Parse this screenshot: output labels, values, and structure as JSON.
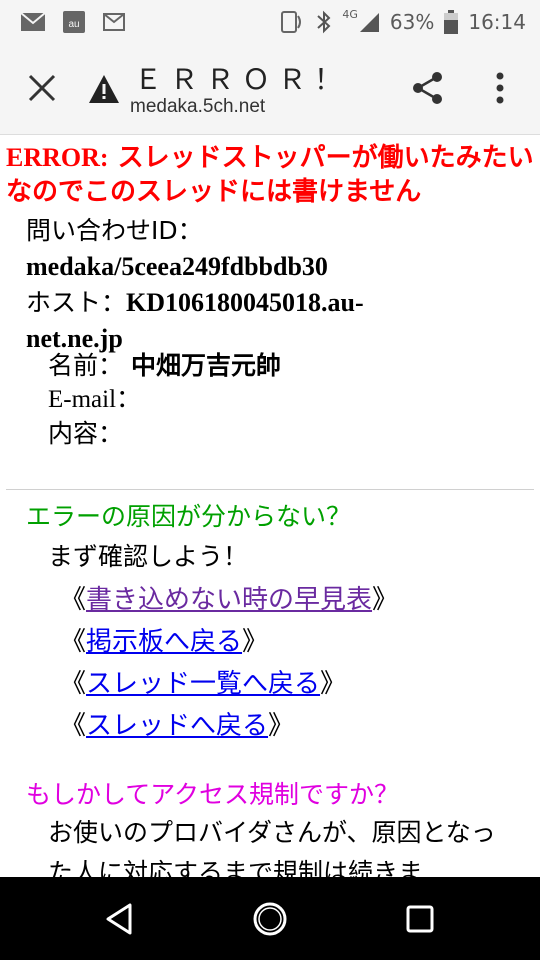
{
  "status_bar": {
    "battery": "63%",
    "time": "16:14",
    "network": "4G"
  },
  "app_bar": {
    "title": "ＥＲＲＯＲ！",
    "url": "medaka.5ch.net"
  },
  "error": {
    "prefix": "ERROR:",
    "message": " スレッドストッパーが働いたみたいなのでこのスレッドには書けません"
  },
  "info": {
    "inquiry_label": "問い合わせID：",
    "inquiry_id": "medaka/5ceea249fdbbdb30",
    "host_label": "ホスト：",
    "host_value_line1": "KD106180045018.au-",
    "host_value_line2": "net.ne.jp",
    "name_label": "名前：",
    "name_value": "中畑万吉元帥",
    "email_label": "E-mail：",
    "content_label": "内容："
  },
  "help": {
    "question": "エラーの原因が分からない？",
    "check": "まず確認しよう！",
    "links": [
      {
        "label": "書き込めない時の早見表",
        "visited": true
      },
      {
        "label": "掲示板へ戻る",
        "visited": false
      },
      {
        "label": "スレッド一覧へ戻る",
        "visited": false
      },
      {
        "label": "スレッドへ戻る",
        "visited": false
      }
    ],
    "bracket_open": "《",
    "bracket_close": "》"
  },
  "regulation": {
    "question": "もしかしてアクセス規制ですか？",
    "text": "お使いのプロバイダさんが、原因となった人に対応するまで規制は続きま"
  },
  "colors": {
    "error": "#ff0000",
    "green": "#00a000",
    "magenta": "#e000e0",
    "link": "#0000ee",
    "visited": "#6a2aa0"
  }
}
